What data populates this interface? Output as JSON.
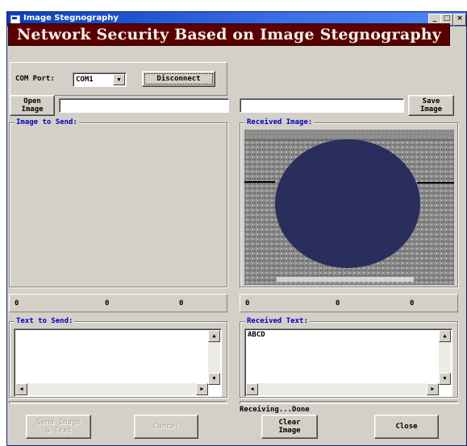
{
  "window": {
    "title": "Image Stegnography",
    "minimize": "_",
    "maximize": "□",
    "close": "×"
  },
  "banner": "Network Security Based on Image Stegnography",
  "com": {
    "label": "COM Port:",
    "selected": "COM1",
    "disconnect": "Disconnect"
  },
  "left": {
    "open_button": "Open\nImage",
    "path_value": "",
    "image_group": "Image to Send:",
    "counts": [
      "0",
      "0",
      "0"
    ],
    "text_group": "Text to Send:",
    "text_value": "",
    "send_button": "Send Image\n& Text",
    "cancel_button": "Cancel"
  },
  "right": {
    "save_button": "Save\nImage",
    "path_value": "",
    "image_group": "Received Image:",
    "counts": [
      "0",
      "0",
      "0"
    ],
    "text_group": "Received Text:",
    "text_value": "ABCD",
    "status": "Receiving...Done",
    "clear_button": "Clear\nImage",
    "close_button": "Close"
  },
  "colors": {
    "titlebar": "#0a3fb8",
    "banner": "#5a0000",
    "group_label": "#0000c0",
    "pupil": "#2a2e5c"
  }
}
